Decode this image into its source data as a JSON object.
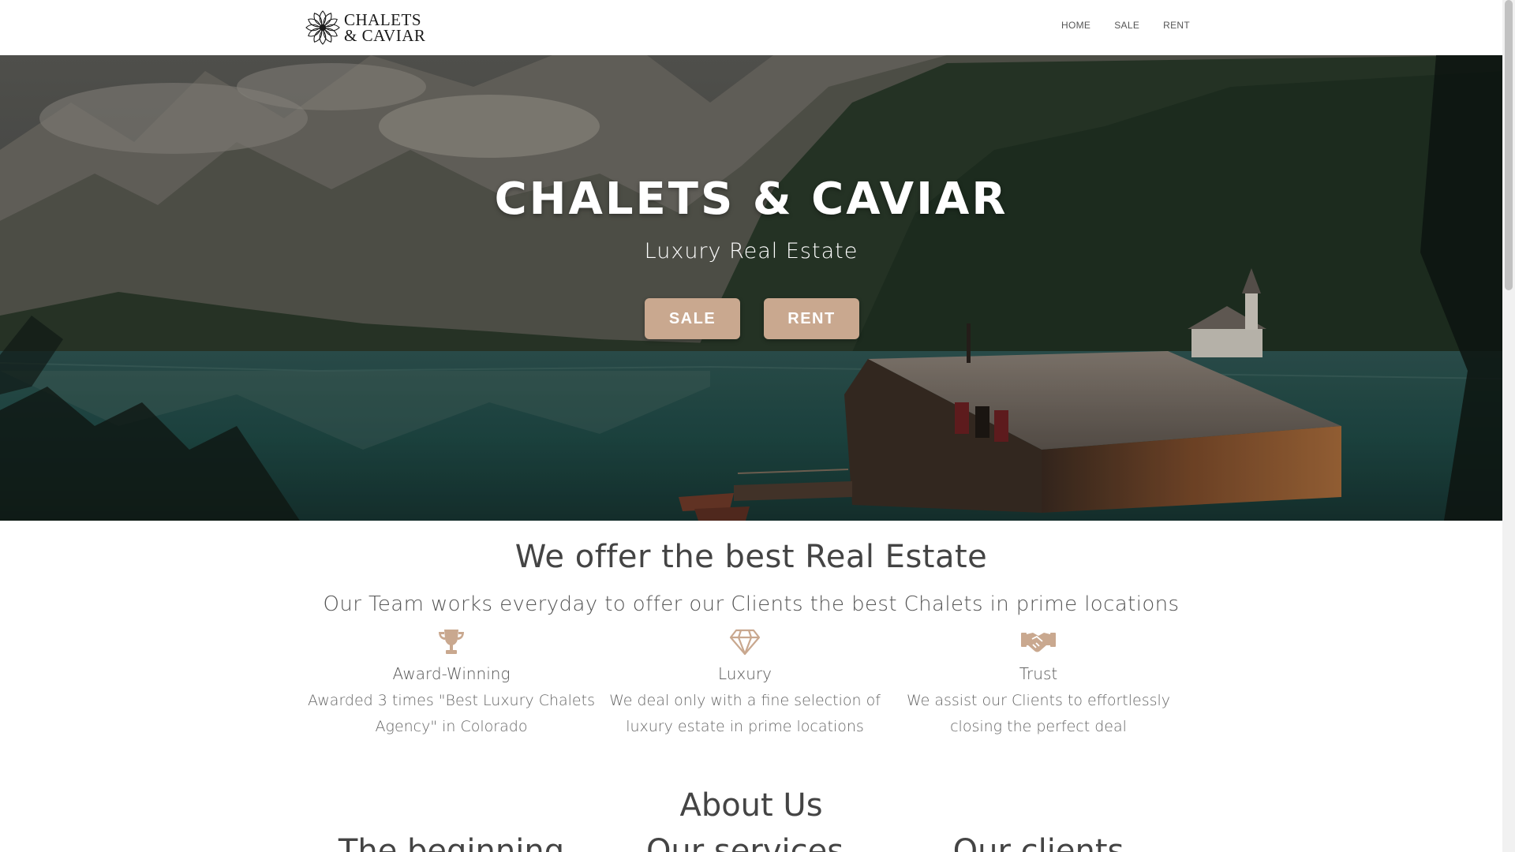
{
  "brand": {
    "line1": "CHALETS",
    "line2": "& CAVIAR"
  },
  "nav": {
    "items": [
      "HOME",
      "SALE",
      "RENT"
    ]
  },
  "hero": {
    "title": "CHALETS & CAVIAR",
    "subtitle": "Luxury Real Estate",
    "buttons": [
      "SALE",
      "RENT"
    ],
    "accent_color": "#c9a88f"
  },
  "offer": {
    "title": "We offer the best Real Estate",
    "subtitle": "Our Team works everyday to offer our Clients the best Chalets in prime locations",
    "features": [
      {
        "icon": "trophy-icon",
        "name": "Award-Winning",
        "desc_line1": "Awarded 3 times \"Best Luxury Chalets",
        "desc_line2": "Agency\" in Colorado"
      },
      {
        "icon": "diamond-icon",
        "name": "Luxury",
        "desc_line1": "We deal only with a fine selection of",
        "desc_line2": "luxury estate in prime locations"
      },
      {
        "icon": "handshake-icon",
        "name": "Trust",
        "desc_line1": "We assist our Clients to effortlessly",
        "desc_line2": "closing the perfect deal"
      }
    ]
  },
  "about": {
    "title": "About Us",
    "columns": [
      "The beginning",
      "Our services",
      "Our clients"
    ]
  }
}
